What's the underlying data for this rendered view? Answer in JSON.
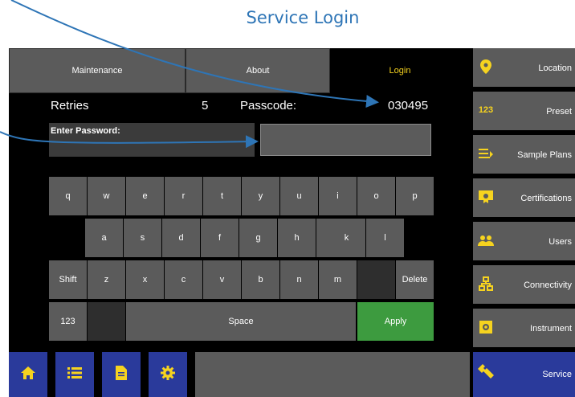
{
  "caption": "Service Login",
  "tabs": {
    "maintenance": "Maintenance",
    "about": "About",
    "login": "Login"
  },
  "info": {
    "retries_label": "Retries",
    "retries_value": "5",
    "passcode_label": "Passcode:",
    "passcode_value": "030495",
    "password_label": "Enter Password:"
  },
  "keyboard": {
    "row1": [
      "q",
      "w",
      "e",
      "r",
      "t",
      "y",
      "u",
      "i",
      "o",
      "p"
    ],
    "row2": [
      "a",
      "s",
      "d",
      "f",
      "g",
      "h",
      "j",
      "k",
      "l"
    ],
    "row3": [
      "z",
      "x",
      "c",
      "v",
      "b",
      "n",
      "m"
    ],
    "shift": "Shift",
    "delete": "Delete",
    "num": "123",
    "space": "Space",
    "apply": "Apply"
  },
  "sidebar": [
    {
      "label": "Location",
      "icon": "location-pin-icon"
    },
    {
      "label": "Preset",
      "icon": "numbers-123-icon"
    },
    {
      "label": "Sample Plans",
      "icon": "list-arrow-icon"
    },
    {
      "label": "Certifications",
      "icon": "certificate-icon"
    },
    {
      "label": "Users",
      "icon": "users-icon"
    },
    {
      "label": "Connectivity",
      "icon": "network-icon"
    },
    {
      "label": "Instrument",
      "icon": "instrument-gear-icon"
    },
    {
      "label": "Service",
      "icon": "wrench-icon"
    }
  ],
  "colors": {
    "accent_yellow": "#f6d31f",
    "nav_blue": "#2a3a9b",
    "apply_green": "#3d9b3f",
    "annotation_blue": "#2e75b6"
  }
}
